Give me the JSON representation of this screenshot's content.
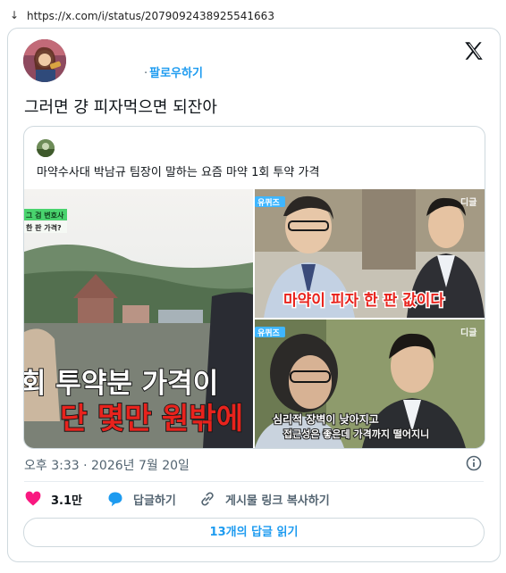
{
  "browser": {
    "url": "https://x.com/i/status/2079092438925541663"
  },
  "tweet": {
    "follow_label": "팔로우하기",
    "text": "그러면 걍 피자먹으면 되잔아",
    "time": "오후 3:33 · 2026년 7월 20일",
    "likes": "3.1만",
    "reply_label": "답글하기",
    "copy_link_label": "게시물 링크 복사하기",
    "read_replies_label": "13개의 답글 읽기"
  },
  "quote": {
    "text": "마약수사대 박남규 팀장이 말하는 요즘 마약 1회 투약 가격"
  },
  "media": {
    "left": {
      "tag_top": "그 검 변호사",
      "tag_bottom": "한 판 가격?",
      "caption_line1": "회 투약분 가격이",
      "caption_line2": "단 몇만 원밖에"
    },
    "top_right": {
      "logo": "유퀴즈",
      "watermark": "디글",
      "caption": "마약이 피자 한 판 값이다"
    },
    "bottom_right": {
      "logo": "유퀴즈",
      "watermark": "디글",
      "caption_line1": "심리적 장벽이 낮아지고",
      "caption_line2": "접근성은 좋은데 가격까지 떨어지니"
    }
  },
  "colors": {
    "accent": "#1d9bf0",
    "like": "#f91880",
    "muted": "#536471",
    "border": "#cfd9de",
    "caption_red": "#e8231d"
  },
  "icons": {
    "download": "down-arrow-icon",
    "brand": "x-logo-icon",
    "info": "info-icon",
    "like": "heart-icon",
    "reply": "speech-bubble-icon",
    "copy": "link-icon"
  }
}
